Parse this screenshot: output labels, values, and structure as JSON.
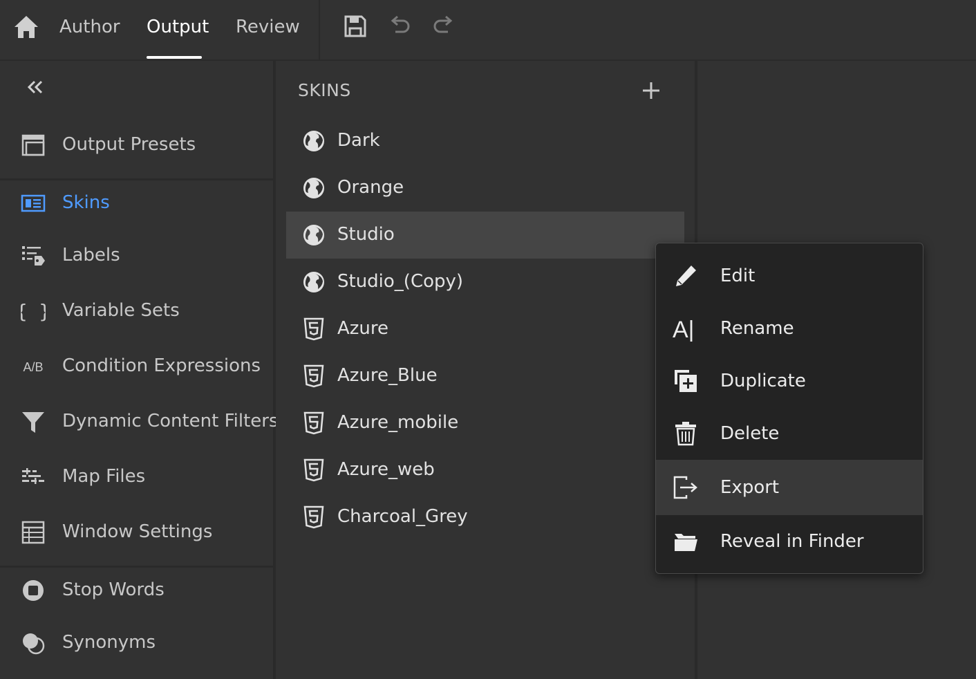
{
  "header": {
    "tabs": [
      {
        "label": "Author"
      },
      {
        "label": "Output"
      },
      {
        "label": "Review"
      }
    ],
    "active_tab": "Output",
    "tools": [
      "save-icon",
      "undo-icon",
      "redo-icon"
    ]
  },
  "sidebar": {
    "items": [
      {
        "label": "Output Presets",
        "icon": "output-presets-icon"
      },
      {
        "label": "Skins",
        "icon": "skins-icon",
        "active": true
      },
      {
        "label": "Labels",
        "icon": "labels-icon"
      },
      {
        "label": "Variable Sets",
        "icon": "braces-icon"
      },
      {
        "label": "Condition Expressions",
        "icon": "ab-icon",
        "icon_text": "A/B"
      },
      {
        "label": "Dynamic Content Filters",
        "icon": "filter-icon"
      },
      {
        "label": "Map Files",
        "icon": "map-files-icon"
      },
      {
        "label": "Window Settings",
        "icon": "window-settings-icon"
      },
      {
        "label": "Stop Words",
        "icon": "stop-words-icon"
      },
      {
        "label": "Synonyms",
        "icon": "synonyms-icon"
      }
    ]
  },
  "skins": {
    "title": "SKINS",
    "items": [
      {
        "label": "Dark",
        "icon": "globe-icon"
      },
      {
        "label": "Orange",
        "icon": "globe-icon"
      },
      {
        "label": "Studio",
        "icon": "globe-icon",
        "selected": true
      },
      {
        "label": "Studio_(Copy)",
        "icon": "globe-icon"
      },
      {
        "label": "Azure",
        "icon": "html5-icon"
      },
      {
        "label": "Azure_Blue",
        "icon": "html5-icon"
      },
      {
        "label": "Azure_mobile",
        "icon": "html5-icon"
      },
      {
        "label": "Azure_web",
        "icon": "html5-icon"
      },
      {
        "label": "Charcoal_Grey",
        "icon": "html5-icon"
      }
    ]
  },
  "context_menu": {
    "items": [
      {
        "label": "Edit",
        "icon": "pencil-icon"
      },
      {
        "label": "Rename",
        "icon": "rename-icon",
        "icon_text": "A|"
      },
      {
        "label": "Duplicate",
        "icon": "duplicate-icon"
      },
      {
        "label": "Delete",
        "icon": "trash-icon"
      },
      {
        "label": "Export",
        "icon": "export-icon",
        "hovered": true
      },
      {
        "label": "Reveal in Finder",
        "icon": "folder-icon"
      }
    ]
  },
  "colors": {
    "background": "#323232",
    "active_accent": "#4f9bff",
    "menu_background": "#232323",
    "selected_row": "#454545"
  }
}
